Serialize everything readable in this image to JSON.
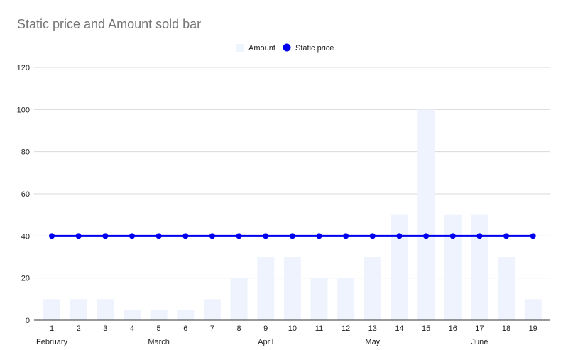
{
  "chart_data": {
    "type": "bar",
    "title": "Static price and Amount sold bar",
    "categories": [
      "1",
      "2",
      "3",
      "4",
      "5",
      "6",
      "7",
      "8",
      "9",
      "10",
      "11",
      "12",
      "13",
      "14",
      "15",
      "16",
      "17",
      "18",
      "19"
    ],
    "group_labels": [
      {
        "label": "February",
        "at": "1"
      },
      {
        "label": "March",
        "at": "5"
      },
      {
        "label": "April",
        "at": "9"
      },
      {
        "label": "May",
        "at": "13"
      },
      {
        "label": "June",
        "at": "17"
      }
    ],
    "series": [
      {
        "name": "Amount",
        "kind": "bar",
        "color": "#eef3fd",
        "values": [
          10,
          10,
          10,
          5,
          5,
          5,
          10,
          20,
          30,
          30,
          20,
          20,
          30,
          50,
          100,
          50,
          50,
          30,
          10
        ]
      },
      {
        "name": "Static price",
        "kind": "line",
        "color": "#0000ee",
        "values": [
          40,
          40,
          40,
          40,
          40,
          40,
          40,
          40,
          40,
          40,
          40,
          40,
          40,
          40,
          40,
          40,
          40,
          40,
          40
        ]
      }
    ],
    "ylim": [
      0,
      120
    ],
    "yticks": [
      0,
      20,
      40,
      60,
      80,
      100,
      120
    ],
    "grid": true,
    "legend": "top-center",
    "xlabel": "",
    "ylabel": ""
  }
}
